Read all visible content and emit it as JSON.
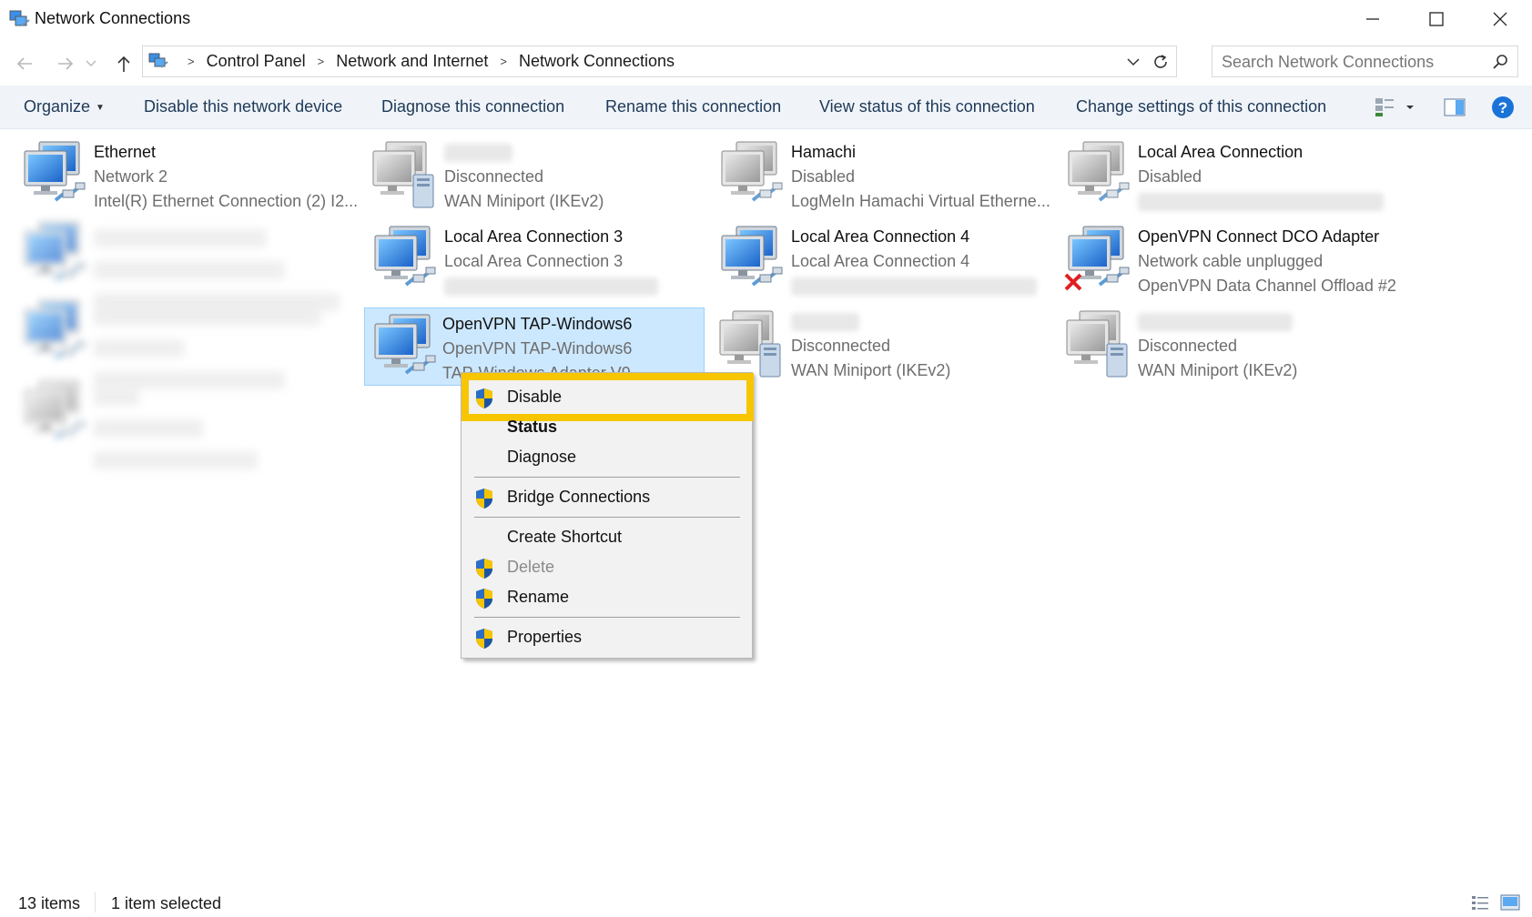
{
  "window": {
    "title": "Network Connections"
  },
  "address": {
    "crumbs": [
      "Control Panel",
      "Network and Internet",
      "Network Connections"
    ]
  },
  "search": {
    "placeholder": "Search Network Connections"
  },
  "commands": {
    "organize": "Organize",
    "disable": "Disable this network device",
    "diagnose": "Diagnose this connection",
    "rename": "Rename this connection",
    "view_status": "View status of this connection",
    "change_settings": "Change settings of this connection"
  },
  "connections": [
    {
      "name": "Ethernet",
      "status": "Network 2",
      "device": "Intel(R) Ethernet Connection (2) I2...",
      "icon": "network-connected-icon"
    },
    {
      "name": "",
      "status": "Disconnected",
      "device": "WAN Miniport (IKEv2)",
      "icon": "wan-miniport-icon"
    },
    {
      "name": "Hamachi",
      "status": "Disabled",
      "device": "LogMeIn Hamachi Virtual Etherne...",
      "icon": "network-disabled-icon"
    },
    {
      "name": "Local Area Connection",
      "status": "Disabled",
      "device": "",
      "icon": "network-disabled-icon"
    },
    {
      "name": "Local Area Connection 3",
      "status": "Local Area Connection 3",
      "device": "",
      "icon": "network-connected-icon"
    },
    {
      "name": "Local Area Connection 4",
      "status": "Local Area Connection 4",
      "device": "",
      "icon": "network-connected-icon"
    },
    {
      "name": "OpenVPN Connect DCO Adapter",
      "status": "Network cable unplugged",
      "device": "OpenVPN Data Channel Offload #2",
      "icon": "network-unplugged-icon"
    },
    {
      "name": "OpenVPN TAP-Windows6",
      "status": "OpenVPN TAP-Windows6",
      "device": "TAP-Windows Adapter V9",
      "icon": "network-connected-icon",
      "selected": true
    },
    {
      "name": "",
      "status": "Disconnected",
      "device": "WAN Miniport (IKEv2)",
      "icon": "wan-miniport-icon"
    },
    {
      "name": "",
      "status": "Disconnected",
      "device": "WAN Miniport (IKEv2)",
      "icon": "wan-miniport-icon"
    }
  ],
  "context_menu": {
    "items": [
      {
        "label": "Disable",
        "shield": true
      },
      {
        "label": "Status",
        "bold": true
      },
      {
        "label": "Diagnose"
      },
      {
        "label": "Bridge Connections",
        "shield": true
      },
      {
        "label": "Create Shortcut"
      },
      {
        "label": "Delete",
        "shield": true,
        "disabled": true
      },
      {
        "label": "Rename",
        "shield": true
      },
      {
        "label": "Properties",
        "shield": true
      }
    ],
    "highlight_color": "#f7c600"
  },
  "status": {
    "count": "13 items",
    "selected": "1 item selected"
  },
  "colors": {
    "selection": "#cce8ff",
    "selection_border": "#99d1ff",
    "command_bar": "#f0f4f9",
    "help_blue": "#1a73d9"
  }
}
